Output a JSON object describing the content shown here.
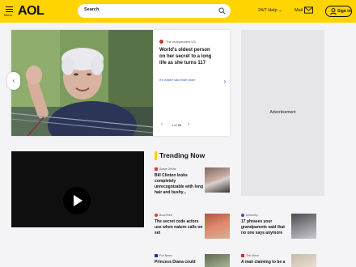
{
  "header": {
    "menu_label": "Menu",
    "logo": "AOL",
    "search_placeholder": "Search",
    "help_label": "24/7 Help",
    "help_caret": "⌄",
    "mail_label": "Mail",
    "signin_label": "Sign in",
    "accent": "#ffd400"
  },
  "hero": {
    "source": "The Independent US",
    "headline": "World's oldest person on her secret to a long life as she turns 117",
    "read_more": "It's easier said than done",
    "pager": "1 of 86",
    "prev_glyph": "‹",
    "next_glyph": "›"
  },
  "ad": {
    "label": "Advertisement"
  },
  "trending": {
    "title": "Trending Now",
    "stories": [
      {
        "source": "Swipe Online",
        "headline": "Bill Clinton looks completely unrecognizable with long hair and bushy..."
      },
      {
        "source": "BuzzFeed",
        "headline": "The secret code actors use when nature calls on set"
      },
      {
        "source": "Upworthy",
        "headline": "17 phrases your grandparents said that no one says anymore"
      },
      {
        "source": "Fox News",
        "headline": "Princess Diana could"
      },
      {
        "source": "The Mirror",
        "headline": "A man claiming to be a"
      }
    ]
  }
}
